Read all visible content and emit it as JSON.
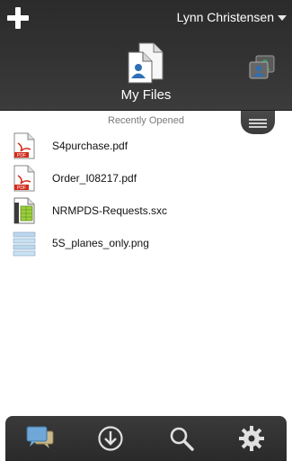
{
  "header": {
    "user_name": "Lynn Christensen",
    "title": "My Files",
    "icons": [
      "plus-icon",
      "files-icon",
      "shared-users-icon",
      "chevron-down-icon"
    ]
  },
  "section": {
    "label": "Recently Opened"
  },
  "files": [
    {
      "name": "S4purchase.pdf",
      "icon": "pdf-file-icon"
    },
    {
      "name": "Order_I08217.pdf",
      "icon": "pdf-file-icon"
    },
    {
      "name": "NRMPDS-Requests.sxc",
      "icon": "spreadsheet-file-icon"
    },
    {
      "name": "5S_planes_only.png",
      "icon": "image-file-icon"
    }
  ],
  "bottom_nav": [
    "chat-icon",
    "download-icon",
    "search-icon",
    "settings-gear-icon"
  ],
  "colors": {
    "header_bg": "#333333",
    "pdf_red": "#d12a1c",
    "accent_blue": "#2e6fb5",
    "accent_green": "#3a9a58"
  }
}
